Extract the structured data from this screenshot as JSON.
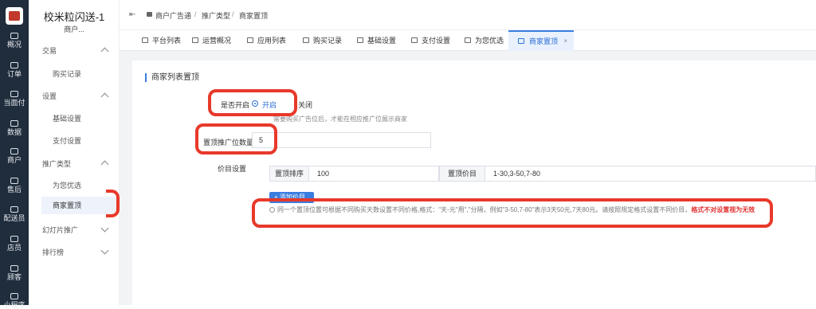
{
  "left_nav": {
    "items": [
      {
        "label": "概况",
        "icon": "grid-icon"
      },
      {
        "label": "订单",
        "icon": "list-icon"
      },
      {
        "label": "当面付",
        "icon": "list-icon"
      },
      {
        "label": "数据",
        "icon": "bar-chart-icon"
      },
      {
        "label": "商户",
        "icon": "store-icon"
      },
      {
        "label": "售后",
        "icon": "headset-icon"
      },
      {
        "label": "配送员",
        "icon": "delivery-icon"
      },
      {
        "label": "店员",
        "icon": "pin-icon"
      },
      {
        "label": "顾客",
        "icon": "user-icon"
      },
      {
        "label": "小程序",
        "icon": "wechat-icon"
      }
    ]
  },
  "sub_nav": {
    "title": "校米粒闪送-1",
    "subtitle": "商户...",
    "groups": [
      {
        "label": "交易",
        "expanded": true,
        "items": [
          "购买记录"
        ]
      },
      {
        "label": "设置",
        "expanded": true,
        "items": [
          "基础设置",
          "支付设置"
        ]
      },
      {
        "label": "推广类型",
        "expanded": true,
        "items": [
          "为您优选",
          "商家置顶"
        ]
      },
      {
        "label": "幻灯片推广",
        "expanded": false,
        "items": []
      },
      {
        "label": "排行榜",
        "expanded": false,
        "items": []
      }
    ],
    "active_item": "商家置顶"
  },
  "breadcrumb": [
    "商户广告通",
    "推广类型",
    "商家置顶"
  ],
  "tabs": [
    {
      "label": "平台列表",
      "icon": "sliders-icon"
    },
    {
      "label": "运营概况",
      "icon": "grid-icon"
    },
    {
      "label": "应用列表",
      "icon": "apps-icon"
    },
    {
      "label": "购买记录",
      "icon": "doc-icon"
    },
    {
      "label": "基础设置",
      "icon": "doc-icon"
    },
    {
      "label": "支付设置",
      "icon": "doc-icon"
    },
    {
      "label": "为您优选",
      "icon": "doc-icon"
    },
    {
      "label": "商家置顶",
      "icon": "doc-icon",
      "active": true,
      "close": "×"
    }
  ],
  "form": {
    "section_title": "商家列表置顶",
    "enable_label": "是否开启",
    "on_label": "开启",
    "off_label": "关闭",
    "enabled": true,
    "hint": "需要购买广告位后，才能在相应推广位展示商家",
    "slots_label": "置顶推广位数量",
    "slots_value": "5",
    "price_label": "价目设置",
    "price_row": {
      "sort_label": "置顶排序",
      "sort_value": "100",
      "price_label": "置顶价目",
      "price_value": "1-30,3-50,7-80"
    },
    "add_button": "+ 添加价目",
    "notice": "同一个置顶位置可根据不同购买天数设置不同价格,格式：\"天-元\"用\",\"分隔，例如\"3-50,7-80\"表示3天50元,7天80元。请按照规定格式设置不同价目，",
    "notice_warning": "格式不对设置视为无效"
  },
  "colors": {
    "accent": "#3a7de0",
    "nav_bg": "#1f2d3d",
    "highlight": "#e8392a",
    "warning": "#e03030"
  }
}
